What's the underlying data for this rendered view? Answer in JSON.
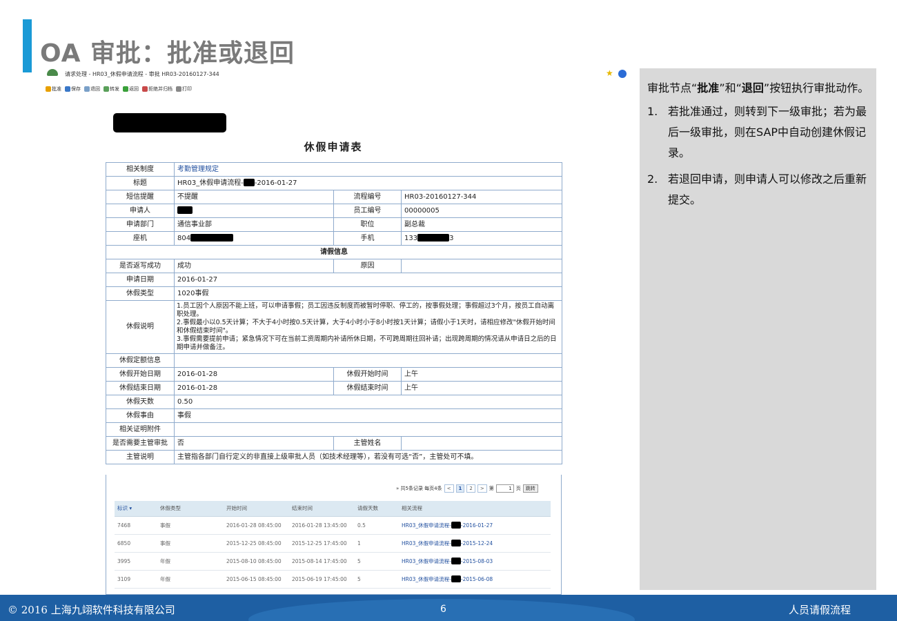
{
  "slide": {
    "title": "OA 审批：批准或退回",
    "footer_copyright": "© 2016 上海九翊软件科技有限公司",
    "footer_page": "6",
    "footer_topic": "人员请假流程"
  },
  "browser": {
    "title_text": "请求处理 - HR03_休假申请流程 - 审批 HR03-20160127-344",
    "toolbar": [
      "批准",
      "保存",
      "退回",
      "转发",
      "返回",
      "拒绝并归档",
      "打印"
    ]
  },
  "form": {
    "title": "休假申请表",
    "labels": {
      "related_policy": "相关制度",
      "subject": "标题",
      "sms": "短信提醒",
      "flow_no": "流程编号",
      "applicant": "申请人",
      "emp_no": "员工编号",
      "dept": "申请部门",
      "position": "职位",
      "phone": "座机",
      "mobile": "手机",
      "section": "请假信息",
      "writeback": "是否返写成功",
      "reason": "原因",
      "apply_date": "申请日期",
      "leave_type": "休假类型",
      "leave_desc": "休假说明",
      "quota": "休假定额信息",
      "start_date": "休假开始日期",
      "start_time": "休假开始时间",
      "end_date": "休假结束日期",
      "end_time": "休假结束时间",
      "days": "休假天数",
      "cause": "休假事由",
      "attachment": "相关证明附件",
      "need_manager": "是否需要主管审批",
      "manager_name": "主管姓名",
      "manager_note": "主管说明"
    },
    "values": {
      "related_policy": "考勤管理规定",
      "subject_prefix": "HR03_休假申请流程-",
      "subject_suffix": "-2016-01-27",
      "sms": "不提醒",
      "flow_no": "HR03-20160127-344",
      "emp_no": "00000005",
      "dept": "通信事业部",
      "position": "副总裁",
      "phone_prefix": "804",
      "mobile_prefix": "133",
      "mobile_suffix": "3",
      "writeback": "成功",
      "apply_date": "2016-01-27",
      "leave_type": "1020事假",
      "leave_desc_1": "1.员工因个人原因不能上班，可以申请事假；员工因违反制度而被暂时停职、停工的，按事假处理；事假超过3个月，按员工自动离职处理。",
      "leave_desc_2": "2.事假最小以0.5天计算；不大于4小时按0.5天计算，大于4小时小于8小时按1天计算；请假小于1天时，请相应修改\"休假开始时间和休假结束时间\"。",
      "leave_desc_3": "3.事假需要提前申请；紧急情况下可在当前工资周期内补请所休日期，不可跨周期往回补请；出现跨周期的情况请从申请日之后的日期申请并做备注。",
      "start_date": "2016-01-28",
      "start_time": "上午",
      "end_date": "2016-01-28",
      "end_time": "上午",
      "days": "0.50",
      "cause": "事假",
      "need_manager": "否",
      "manager_note": "主管指各部门自行定义的非直接上级审批人员（如技术经理等），若没有可选“否”，主管处可不填。"
    }
  },
  "pager": {
    "summary": "» 共5条记录  每页4条",
    "pages": [
      "<",
      "1",
      "2",
      ">"
    ],
    "goto_label_pre": "第",
    "goto_value": "1",
    "goto_label_post": "页",
    "goto_button": "跳转"
  },
  "records": {
    "headers": [
      "标识 ▾",
      "休假类型",
      "开始时间",
      "结束时间",
      "请假天数",
      "相关流程"
    ],
    "rows": [
      {
        "id": "7468",
        "type": "事假",
        "start": "2016-01-28 08:45:00",
        "end": "2016-01-28 13:45:00",
        "days": "0.5",
        "flow_prefix": "HR03_休假申请流程-",
        "flow_suffix": "-2016-01-27"
      },
      {
        "id": "6850",
        "type": "事假",
        "start": "2015-12-25 08:45:00",
        "end": "2015-12-25 17:45:00",
        "days": "1",
        "flow_prefix": "HR03_休假申请流程-",
        "flow_suffix": "-2015-12-24"
      },
      {
        "id": "3995",
        "type": "年假",
        "start": "2015-08-10 08:45:00",
        "end": "2015-08-14 17:45:00",
        "days": "5",
        "flow_prefix": "HR03_休假申请流程-",
        "flow_suffix": "-2015-08-03"
      },
      {
        "id": "3109",
        "type": "年假",
        "start": "2015-06-15 08:45:00",
        "end": "2015-06-19 17:45:00",
        "days": "5",
        "flow_prefix": "HR03_休假申请流程-",
        "flow_suffix": "-2015-06-08"
      }
    ]
  },
  "note": {
    "intro_1": "审批节点“",
    "intro_bold_1": "批准",
    "intro_2": "”和“",
    "intro_bold_2": "退回",
    "intro_3": "”按钮执行审批动作。",
    "items": [
      {
        "num": "1.",
        "text": "若批准通过，则转到下一级审批；若为最后一级审批，则在SAP中自动创建休假记录。"
      },
      {
        "num": "2.",
        "text": "若退回申请，则申请人可以修改之后重新提交。"
      }
    ]
  },
  "colors": {
    "accent": "#1a9ad6",
    "footer": "#1e5fa3",
    "link": "#1f4e9e",
    "note_bg": "#d9d9d9"
  }
}
